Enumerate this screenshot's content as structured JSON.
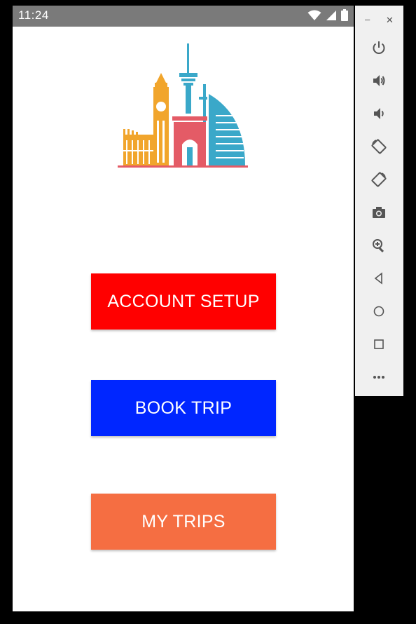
{
  "status_bar": {
    "time": "11:24",
    "icons": [
      "wifi-icon",
      "signal-icon",
      "battery-icon"
    ]
  },
  "main": {
    "logo": "city-landmarks-logo",
    "buttons": {
      "account_setup": "ACCOUNT SETUP",
      "book_trip": "BOOK TRIP",
      "my_trips": "MY TRIPS"
    }
  },
  "colors": {
    "account_setup": "#ff0000",
    "book_trip": "#0026ff",
    "my_trips": "#f56e42",
    "status_bar": "#7a7a7a",
    "panel": "#f0f0f0"
  },
  "emulator_panel": {
    "window_controls": [
      "minimize-icon",
      "close-icon"
    ],
    "buttons": [
      "power-icon",
      "volume-up-icon",
      "volume-down-icon",
      "rotate-left-icon",
      "rotate-right-icon",
      "camera-icon",
      "zoom-icon",
      "back-icon",
      "home-icon",
      "overview-icon",
      "more-icon"
    ]
  }
}
